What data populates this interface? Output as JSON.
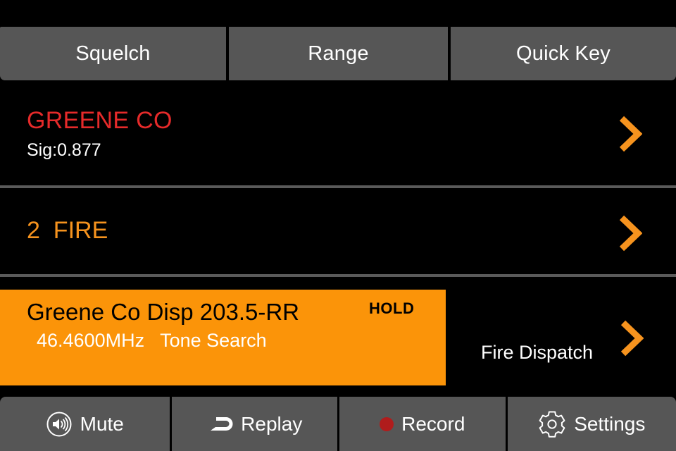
{
  "topbar": {
    "buttons": [
      {
        "label": "Squelch",
        "name": "squelch-button"
      },
      {
        "label": "Range",
        "name": "range-button"
      },
      {
        "label": "Quick Key",
        "name": "quick-key-button"
      }
    ]
  },
  "system_row": {
    "name": "GREENE CO",
    "signal": "Sig:0.877",
    "name_color": "#e52a2a",
    "chevron": "chevron-right-icon"
  },
  "department_row": {
    "label": "2  FIRE",
    "number": "2",
    "text": "FIRE",
    "color": "#f6931e",
    "chevron": "chevron-right-icon"
  },
  "channel_row": {
    "title": "Greene Co Disp 203.5-RR",
    "frequency": "46.4600MHz",
    "mode": "Tone Search",
    "subtitle": "46.4600MHz   Tone Search",
    "status": "HOLD",
    "group": "Fire Dispatch",
    "highlight_color": "#fb9409",
    "chevron": "chevron-right-icon"
  },
  "bottombar": {
    "buttons": [
      {
        "label": "Mute",
        "name": "mute-button",
        "icon": "speaker-icon"
      },
      {
        "label": "Replay",
        "name": "replay-button",
        "icon": "replay-icon"
      },
      {
        "label": "Record",
        "name": "record-button",
        "icon": "record-dot-icon"
      },
      {
        "label": "Settings",
        "name": "settings-button",
        "icon": "gear-icon"
      }
    ]
  },
  "colors": {
    "background": "#000000",
    "button_gray": "#565656",
    "accent_orange": "#f6931e",
    "alert_red": "#e52a2a",
    "record_red": "#b01c1c",
    "divider_gray": "#5a5a5a"
  }
}
